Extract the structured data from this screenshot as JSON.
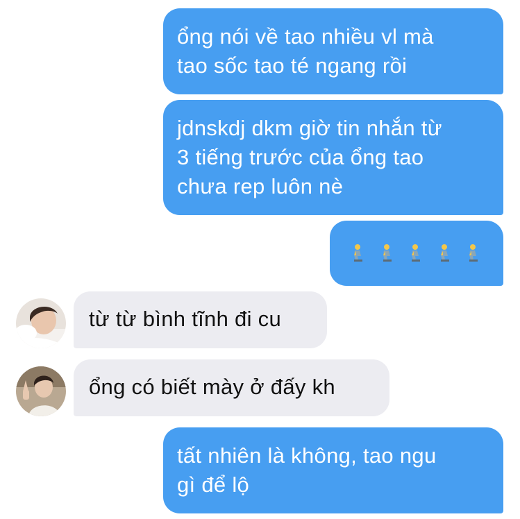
{
  "colors": {
    "outgoing_bubble": "#479ef1",
    "incoming_bubble": "#ececf1",
    "outgoing_text": "#ffffff",
    "incoming_text": "#111111"
  },
  "messages": [
    {
      "direction": "outgoing",
      "lines": [
        "ổng nói về tao nhiều vl mà",
        "tao sốc tao té ngang rồi"
      ]
    },
    {
      "direction": "outgoing",
      "lines": [
        "jdnskdj dkm giờ tin nhắn từ",
        "3 tiếng trước của ổng tao",
        "chưa rep luôn nè"
      ]
    },
    {
      "direction": "outgoing",
      "emoji": [
        "person-kneeling-emoji",
        "person-kneeling-emoji",
        "person-kneeling-emoji",
        "person-kneeling-emoji",
        "person-kneeling-emoji"
      ]
    },
    {
      "direction": "incoming",
      "avatar": "contact-avatar-1",
      "lines": [
        "từ từ bình tĩnh đi cu"
      ]
    },
    {
      "direction": "incoming",
      "avatar": "contact-avatar-2",
      "lines": [
        "ổng có biết mày ở đấy kh"
      ]
    },
    {
      "direction": "outgoing",
      "lines": [
        "tất nhiên là không, tao ngu",
        "gì để lộ"
      ]
    }
  ]
}
